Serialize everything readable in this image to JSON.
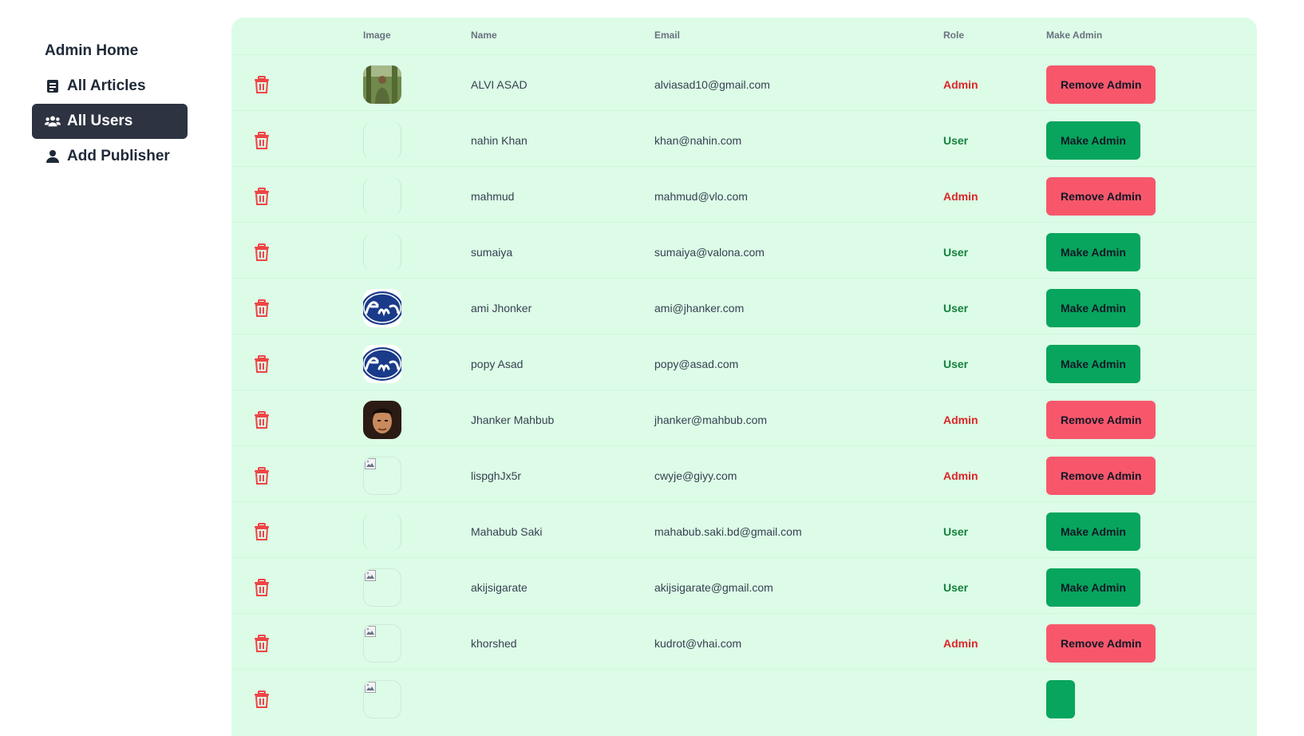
{
  "sidebar": {
    "items": [
      {
        "label": "Admin Home",
        "icon": "none",
        "active": false
      },
      {
        "label": "All Articles",
        "icon": "article-icon",
        "active": false
      },
      {
        "label": "All Users",
        "icon": "users-icon",
        "active": true
      },
      {
        "label": "Add Publisher",
        "icon": "user-add-icon",
        "active": false
      }
    ]
  },
  "table": {
    "headers": {
      "image": "Image",
      "name": "Name",
      "email": "Email",
      "role": "Role",
      "make_admin": "Make Admin"
    },
    "rows": [
      {
        "name": "ALVI ASAD",
        "email": "alviasad10@gmail.com",
        "role": "Admin",
        "action": "Remove Admin",
        "avatar": "photo-man-outdoors"
      },
      {
        "name": "nahin Khan",
        "email": "khan@nahin.com",
        "role": "User",
        "action": "Make Admin",
        "avatar": "empty"
      },
      {
        "name": "mahmud",
        "email": "mahmud@vlo.com",
        "role": "Admin",
        "action": "Remove Admin",
        "avatar": "empty"
      },
      {
        "name": "sumaiya",
        "email": "sumaiya@valona.com",
        "role": "User",
        "action": "Make Admin",
        "avatar": "empty"
      },
      {
        "name": "ami Jhonker",
        "email": "ami@jhanker.com",
        "role": "User",
        "action": "Make Admin",
        "avatar": "ford-logo"
      },
      {
        "name": "popy Asad",
        "email": "popy@asad.com",
        "role": "User",
        "action": "Make Admin",
        "avatar": "ford-logo"
      },
      {
        "name": "Jhanker Mahbub",
        "email": "jhanker@mahbub.com",
        "role": "Admin",
        "action": "Remove Admin",
        "avatar": "photo-man-portrait"
      },
      {
        "name": "lispghJx5r",
        "email": "cwyje@giyy.com",
        "role": "Admin",
        "action": "Remove Admin",
        "avatar": "broken-image"
      },
      {
        "name": "Mahabub Saki",
        "email": "mahabub.saki.bd@gmail.com",
        "role": "User",
        "action": "Make Admin",
        "avatar": "empty"
      },
      {
        "name": "akijsigarate",
        "email": "akijsigarate@gmail.com",
        "role": "User",
        "action": "Make Admin",
        "avatar": "broken-image"
      },
      {
        "name": "khorshed",
        "email": "kudrot@vhai.com",
        "role": "Admin",
        "action": "Remove Admin",
        "avatar": "broken-image"
      },
      {
        "name": "",
        "email": "",
        "role": "",
        "action": "",
        "avatar": "broken-image"
      }
    ]
  },
  "colors": {
    "card_bg": "#dcfce7",
    "active_nav_bg": "#2d3340",
    "remove_btn": "#f8576b",
    "make_btn": "#07a55d",
    "admin_text": "#dc2626",
    "user_text": "#15803d",
    "trash": "#ef4444"
  }
}
